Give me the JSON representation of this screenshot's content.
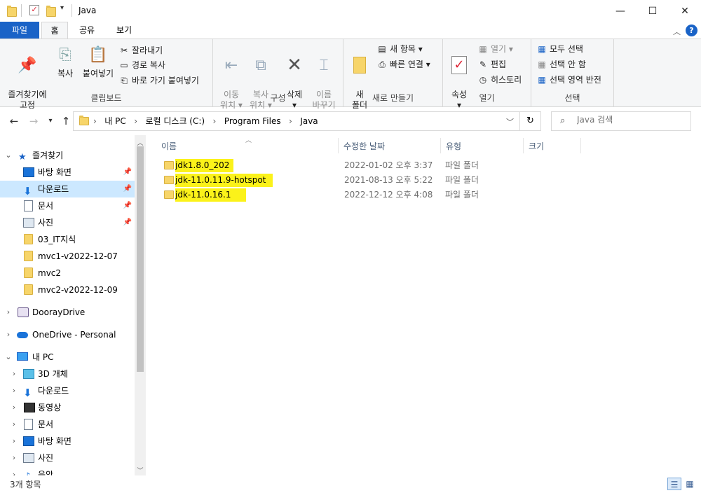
{
  "window": {
    "title": "Java",
    "minimize": "—",
    "maximize": "☐",
    "close": "✕"
  },
  "ribbon_tabs": [
    "파일",
    "홈",
    "공유",
    "보기"
  ],
  "ribbon": {
    "clipboard": {
      "label": "클립보드",
      "pin": "즐겨찾기에\n고정",
      "copy": "복사",
      "paste": "붙여넣기",
      "cut": "잘라내기",
      "copy_path": "경로 복사",
      "paste_shortcut": "바로 가기 붙여넣기"
    },
    "organize": {
      "label": "구성",
      "move_to": "이동\n위치 ▾",
      "copy_to": "복사\n위치 ▾",
      "delete": "삭제\n▾",
      "rename": "이름\n바꾸기"
    },
    "new": {
      "label": "새로 만들기",
      "new_folder": "새\n폴더",
      "new_item": "새 항목 ▾",
      "easy_access": "빠른 연결 ▾"
    },
    "open": {
      "label": "열기",
      "properties": "속성\n▾",
      "open": "열기 ▾",
      "edit": "편집",
      "history": "히스토리"
    },
    "select": {
      "label": "선택",
      "select_all": "모두 선택",
      "select_none": "선택 안 함",
      "invert": "선택 영역 반전"
    }
  },
  "address": {
    "crumbs": [
      "내 PC",
      "로컬 디스크 (C:)",
      "Program Files",
      "Java"
    ],
    "search_placeholder": "Java 검색"
  },
  "nav": {
    "quick_access": "즐겨찾기",
    "items": [
      {
        "label": "바탕 화면",
        "pinned": true
      },
      {
        "label": "다운로드",
        "pinned": true,
        "selected": true
      },
      {
        "label": "문서",
        "pinned": true
      },
      {
        "label": "사진",
        "pinned": true
      },
      {
        "label": "03_IT지식"
      },
      {
        "label": "mvc1-v2022-12-07"
      },
      {
        "label": "mvc2"
      },
      {
        "label": "mvc2-v2022-12-09"
      }
    ],
    "dooray": "DoorayDrive",
    "onedrive": "OneDrive - Personal",
    "this_pc": "내 PC",
    "pc_items": [
      "3D 개체",
      "다운로드",
      "동영상",
      "문서",
      "바탕 화면",
      "사진",
      "음악"
    ]
  },
  "columns": [
    "이름",
    "수정한 날짜",
    "유형",
    "크기"
  ],
  "files": [
    {
      "name": "jdk1.8.0_202",
      "date": "2022-01-02 오후 3:37",
      "type": "파일 폴더"
    },
    {
      "name": "jdk-11.0.11.9-hotspot",
      "date": "2021-08-13 오후 5:22",
      "type": "파일 폴더"
    },
    {
      "name": "jdk-11.0.16.1",
      "date": "2022-12-12 오후 4:08",
      "type": "파일 폴더"
    }
  ],
  "status": {
    "count": "3개 항목"
  },
  "colors": {
    "accent": "#1a63c7",
    "highlight": "#fbf21a",
    "selected": "#cce8ff"
  }
}
